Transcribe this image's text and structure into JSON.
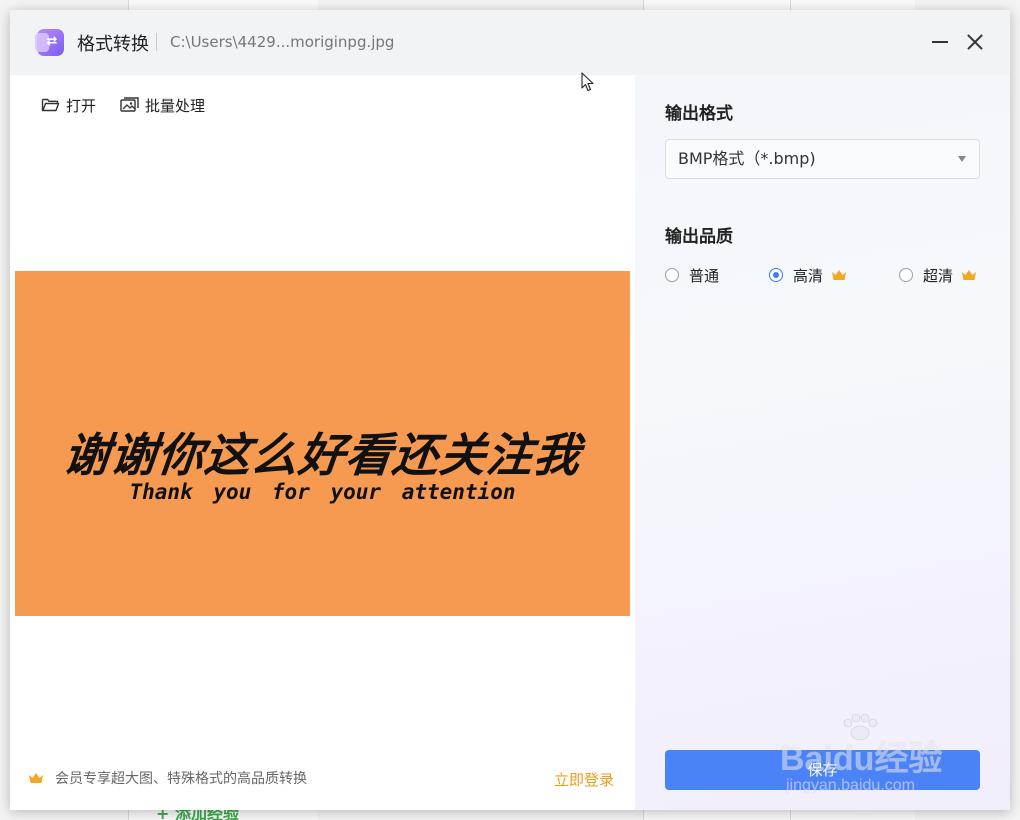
{
  "window": {
    "app_title": "格式转换",
    "file_path": "C:\\Users\\4429...moriginpg.jpg"
  },
  "toolbar": {
    "open_label": "打开",
    "batch_label": "批量处理"
  },
  "preview": {
    "title_cn": "谢谢你这么好看还关注我",
    "title_en": "Thank you for your attention",
    "background_color": "#f69a52"
  },
  "footer": {
    "member_text": "会员专享超大图、特殊格式的高品质转换",
    "login_label": "立即登录"
  },
  "settings": {
    "format_label": "输出格式",
    "format_value": "BMP格式（*.bmp)",
    "quality_label": "输出品质",
    "quality_options": [
      {
        "label": "普通",
        "checked": false,
        "premium": false
      },
      {
        "label": "高清",
        "checked": true,
        "premium": true
      },
      {
        "label": "超清",
        "checked": false,
        "premium": true
      }
    ],
    "save_label": "保存"
  },
  "watermark": {
    "brand": "Baidu经验",
    "url": "jingyan.baidu.com"
  },
  "background": {
    "partial_text_bottom": "+ 添加经验"
  },
  "colors": {
    "accent": "#4a82f7",
    "login": "#f29a1b",
    "crown": "#f5a623"
  }
}
